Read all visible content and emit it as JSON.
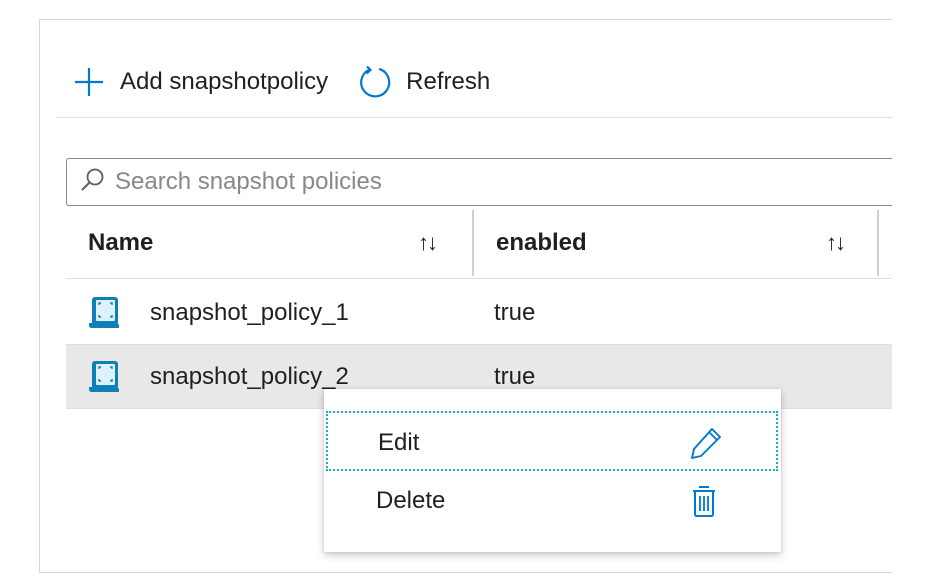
{
  "toolbar": {
    "add_label": "Add snapshotpolicy",
    "add_icon": "plus-icon",
    "refresh_label": "Refresh",
    "refresh_icon": "refresh-icon"
  },
  "search": {
    "placeholder": "Search snapshot policies",
    "value": "",
    "icon": "search-icon"
  },
  "table": {
    "columns": [
      {
        "label": "Name",
        "sort_icon": "↑↓"
      },
      {
        "label": "enabled",
        "sort_icon": "↑↓"
      }
    ],
    "rows": [
      {
        "name": "snapshot_policy_1",
        "enabled": "true",
        "icon": "snapshot-policy-icon",
        "selected": false
      },
      {
        "name": "snapshot_policy_2",
        "enabled": "true",
        "icon": "snapshot-policy-icon",
        "selected": true
      }
    ]
  },
  "context_menu": {
    "items": [
      {
        "label": "Edit",
        "icon": "pencil-icon",
        "focused": true
      },
      {
        "label": "Delete",
        "icon": "trash-icon",
        "focused": false
      }
    ]
  },
  "colors": {
    "accent": "#0078d4",
    "focus_outline": "#28a8c9",
    "selected_row": "#e8e8e8",
    "border": "#d6d6d6"
  }
}
